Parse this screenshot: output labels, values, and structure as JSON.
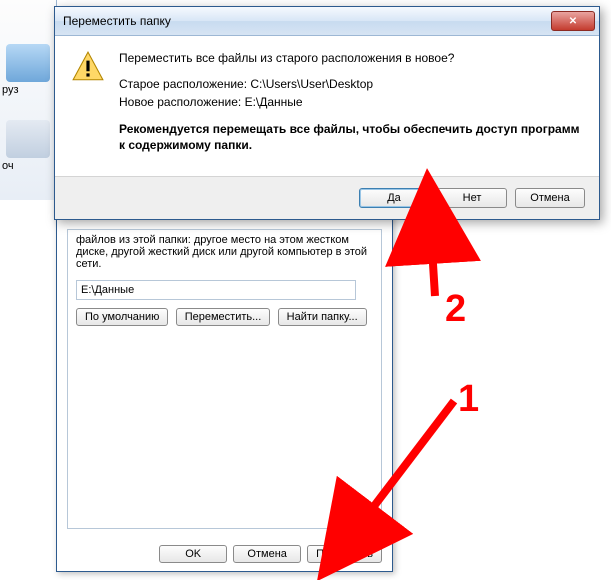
{
  "bg": {
    "label1": "руз",
    "label2": "оч"
  },
  "properties": {
    "description": "файлов из этой папки: другое место на этом жестком диске, другой жесткий диск или другой компьютер в этой сети.",
    "path": "E:\\Данные",
    "btn_default": "По умолчанию",
    "btn_move": "Переместить...",
    "btn_find": "Найти папку...",
    "btn_ok": "OK",
    "btn_cancel": "Отмена",
    "btn_apply": "Применить"
  },
  "dialog": {
    "title": "Переместить папку",
    "question": "Переместить все файлы из старого расположения в новое?",
    "old": "Старое расположение: C:\\Users\\User\\Desktop",
    "new": "Новое расположение: E:\\Данные",
    "recommend": "Рекомендуется перемещать все файлы, чтобы обеспечить доступ программ к содержимому папки.",
    "yes": "Да",
    "no": "Нет",
    "cancel": "Отмена"
  },
  "annot": {
    "n1": "1",
    "n2": "2"
  }
}
